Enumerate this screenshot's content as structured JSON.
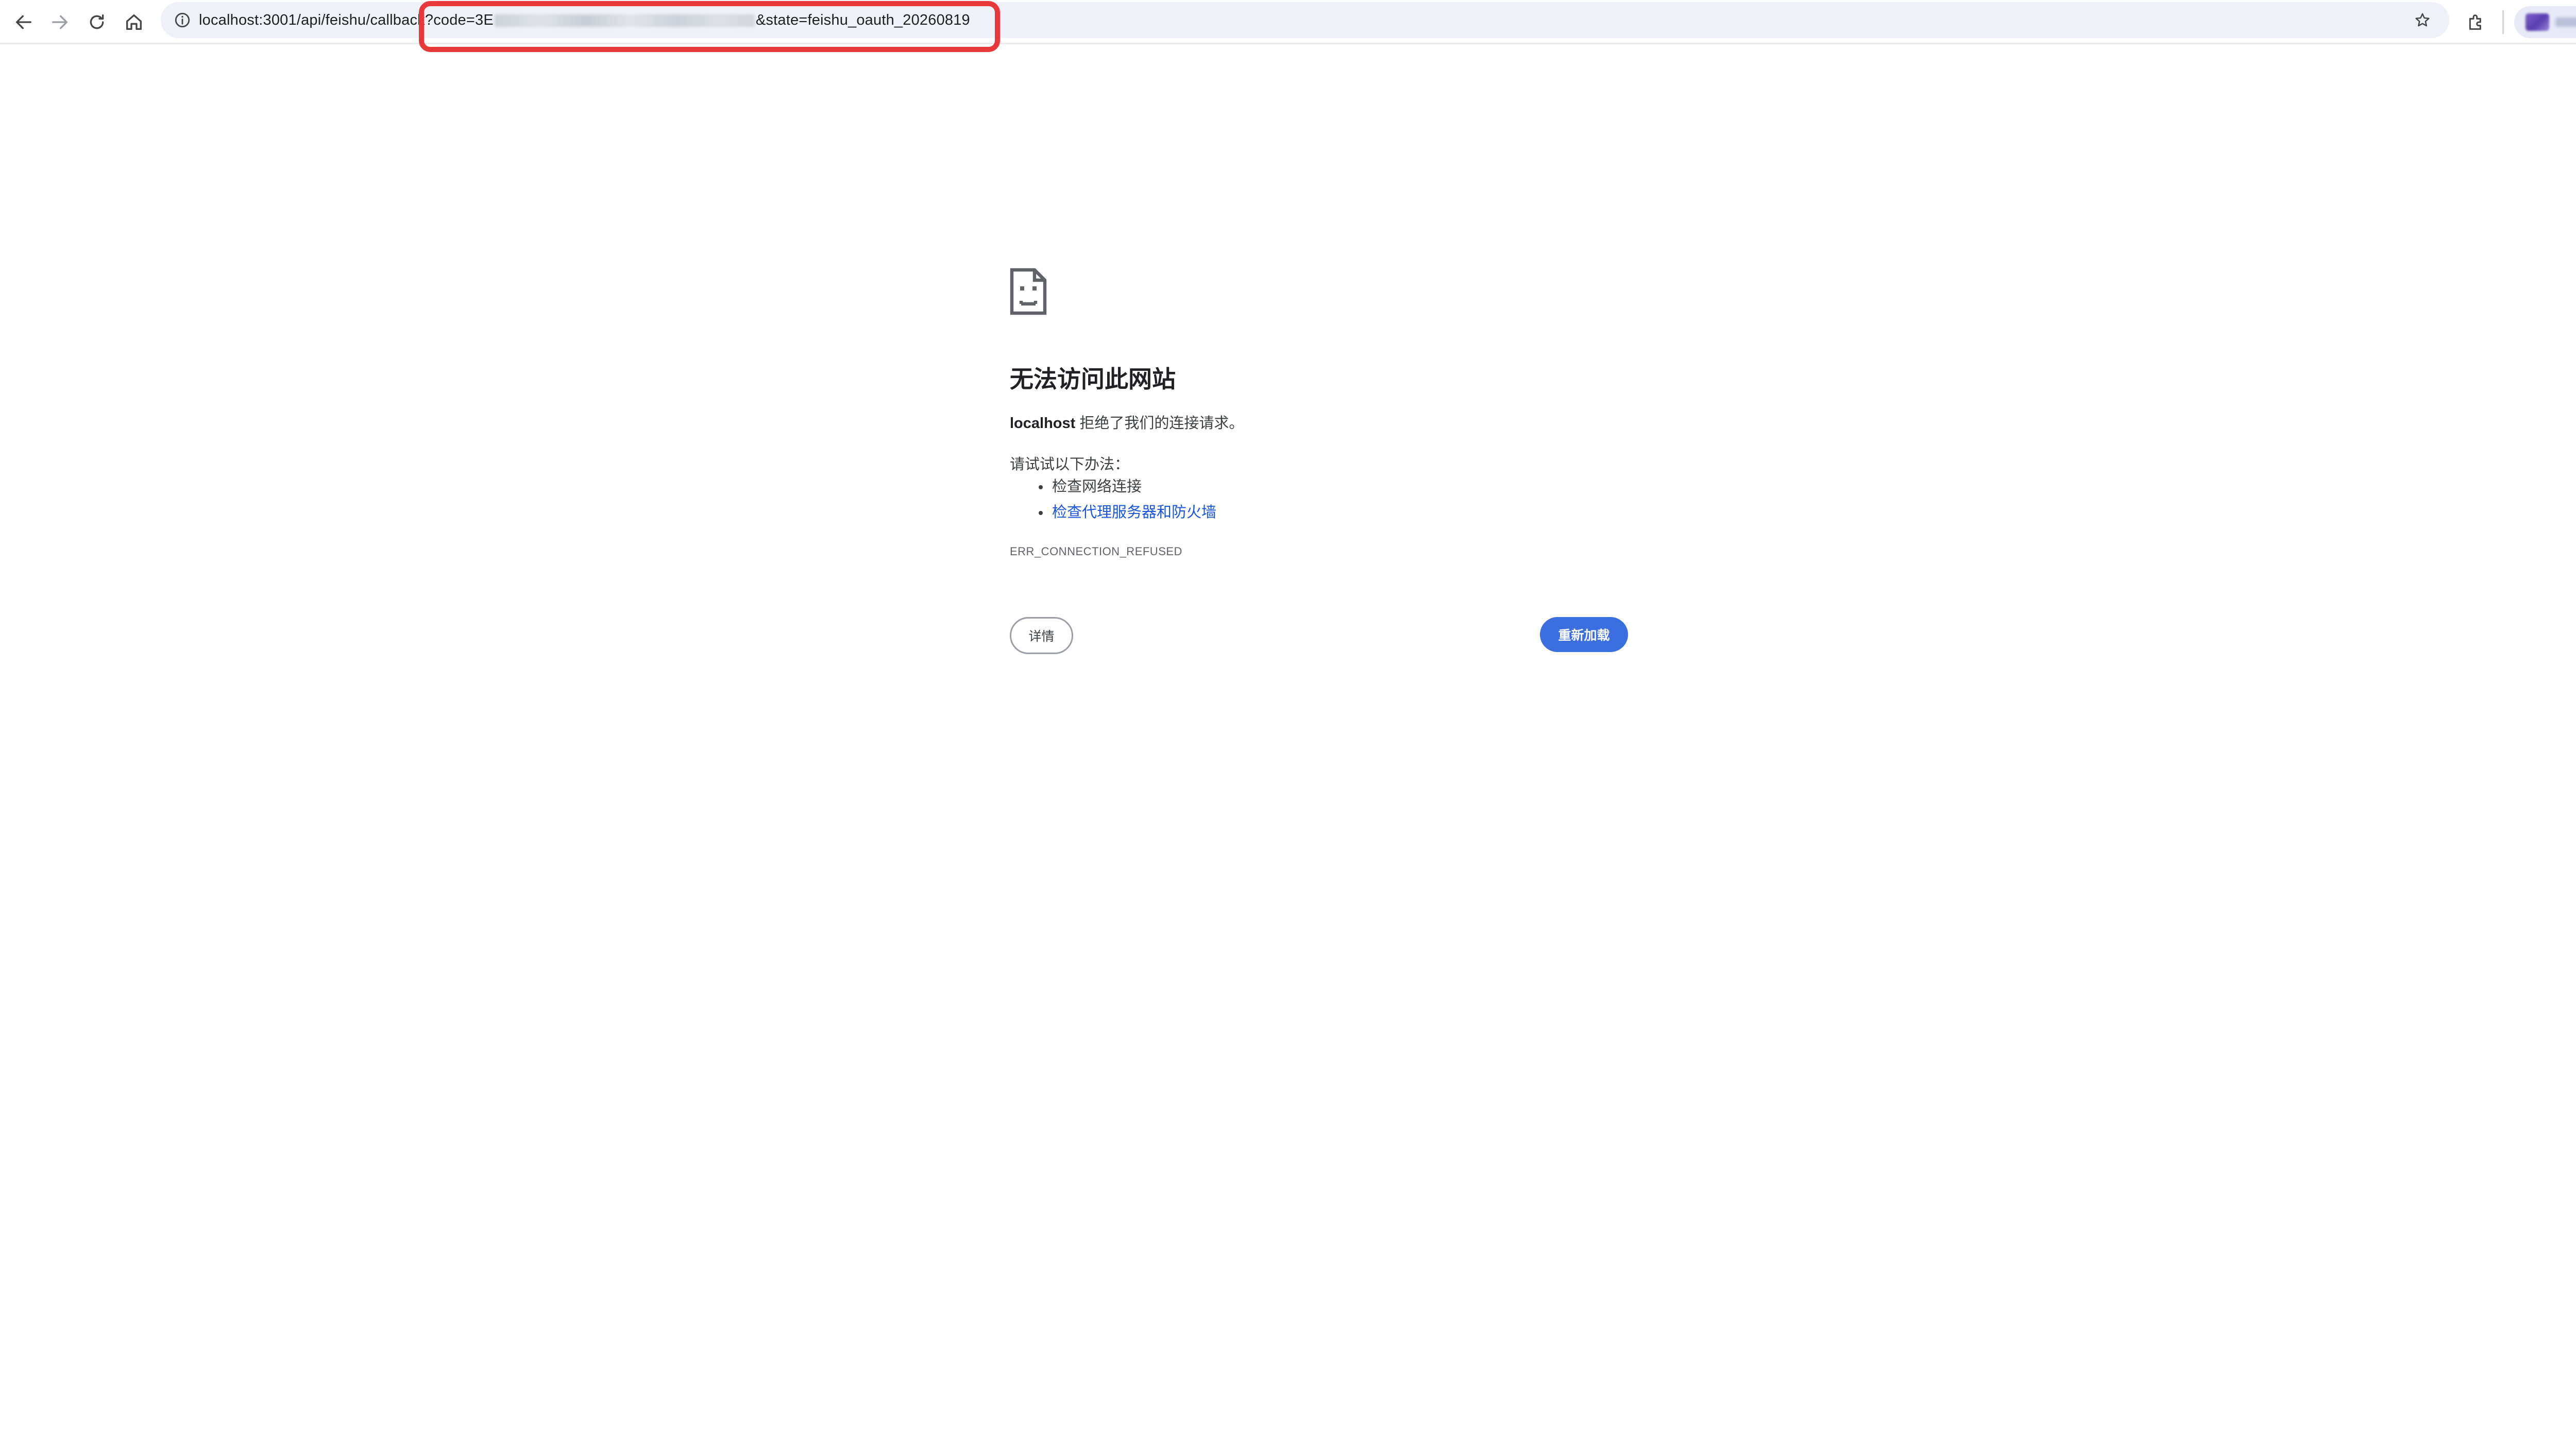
{
  "toolbar": {
    "url_prefix": "localhost:3001/api/feishu/callback",
    "url_query_start": "?code=3E",
    "url_query_end": "&state=feishu_oauth_20260819",
    "icons": {
      "back": "arrow-left-icon",
      "forward": "arrow-right-icon",
      "reload": "reload-icon",
      "home": "home-icon",
      "info": "info-icon",
      "bookmark": "star-icon",
      "extensions": "puzzle-icon",
      "menu": "kebab-menu-icon"
    },
    "highlight_color": "#e8383a"
  },
  "error": {
    "icon": "sad-page-icon",
    "title": "无法访问此网站",
    "host": "localhost",
    "desc_rest": " 拒绝了我们的连接请求。",
    "try_label": "请试试以下办法：",
    "suggestions": [
      "检查网络连接",
      "检查代理服务器和防火墙"
    ],
    "code": "ERR_CONNECTION_REFUSED",
    "details_label": "详情",
    "reload_label": "重新加载",
    "colors": {
      "link": "#1a56db",
      "primary_button": "#3b6fe0"
    }
  }
}
